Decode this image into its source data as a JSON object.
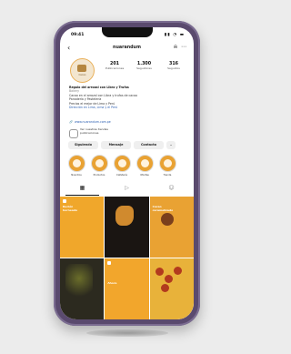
{
  "status": {
    "time": "09:41",
    "icons": "▮▮ ◔ ▬"
  },
  "nav": {
    "back": "‹",
    "username": "nuarandum",
    "bell": "⍾",
    "more": "⋯"
  },
  "profile": {
    "avatar_text": "Cacao",
    "stats": [
      {
        "n": "201",
        "l": "Publicaciones"
      },
      {
        "n": "1.300",
        "l": "Seguidores"
      },
      {
        "n": "316",
        "l": "Seguidos"
      }
    ],
    "bio": {
      "name": "Regalo del arrozal con Libra y Trufas",
      "category": "Bakery",
      "lines": [
        "Cacao en el arrozal con Libra y trufas de cacao",
        "Panadería y Pastelería",
        "Precios el mejor de Lima y Perú"
      ],
      "link": "Dirección en Lima, Lima y el Perú"
    },
    "website": "www.nuarandum.com.pe",
    "threads": {
      "line1": "Ver nuestras tiendas",
      "line2": "publicaciones"
    }
  },
  "buttons": {
    "follow": "Siguiendo",
    "message": "Mensaje",
    "contact": "Contacto",
    "more": "⌄"
  },
  "highlights": [
    {
      "label": "Nosotros"
    },
    {
      "label": "Productos"
    },
    {
      "label": "Cafetería"
    },
    {
      "label": "Ofertas"
    },
    {
      "label": "Tienda"
    }
  ],
  "tabs": [
    {
      "icon": "▦"
    },
    {
      "icon": "▷"
    },
    {
      "icon": "☺"
    }
  ],
  "posts": [
    {
      "caption": "Recién\nhorneado"
    },
    {
      "caption": ""
    },
    {
      "caption": "Cacao\ncaramelizado"
    },
    {
      "caption": ""
    },
    {
      "caption": "Ahora"
    },
    {
      "caption": ""
    }
  ]
}
